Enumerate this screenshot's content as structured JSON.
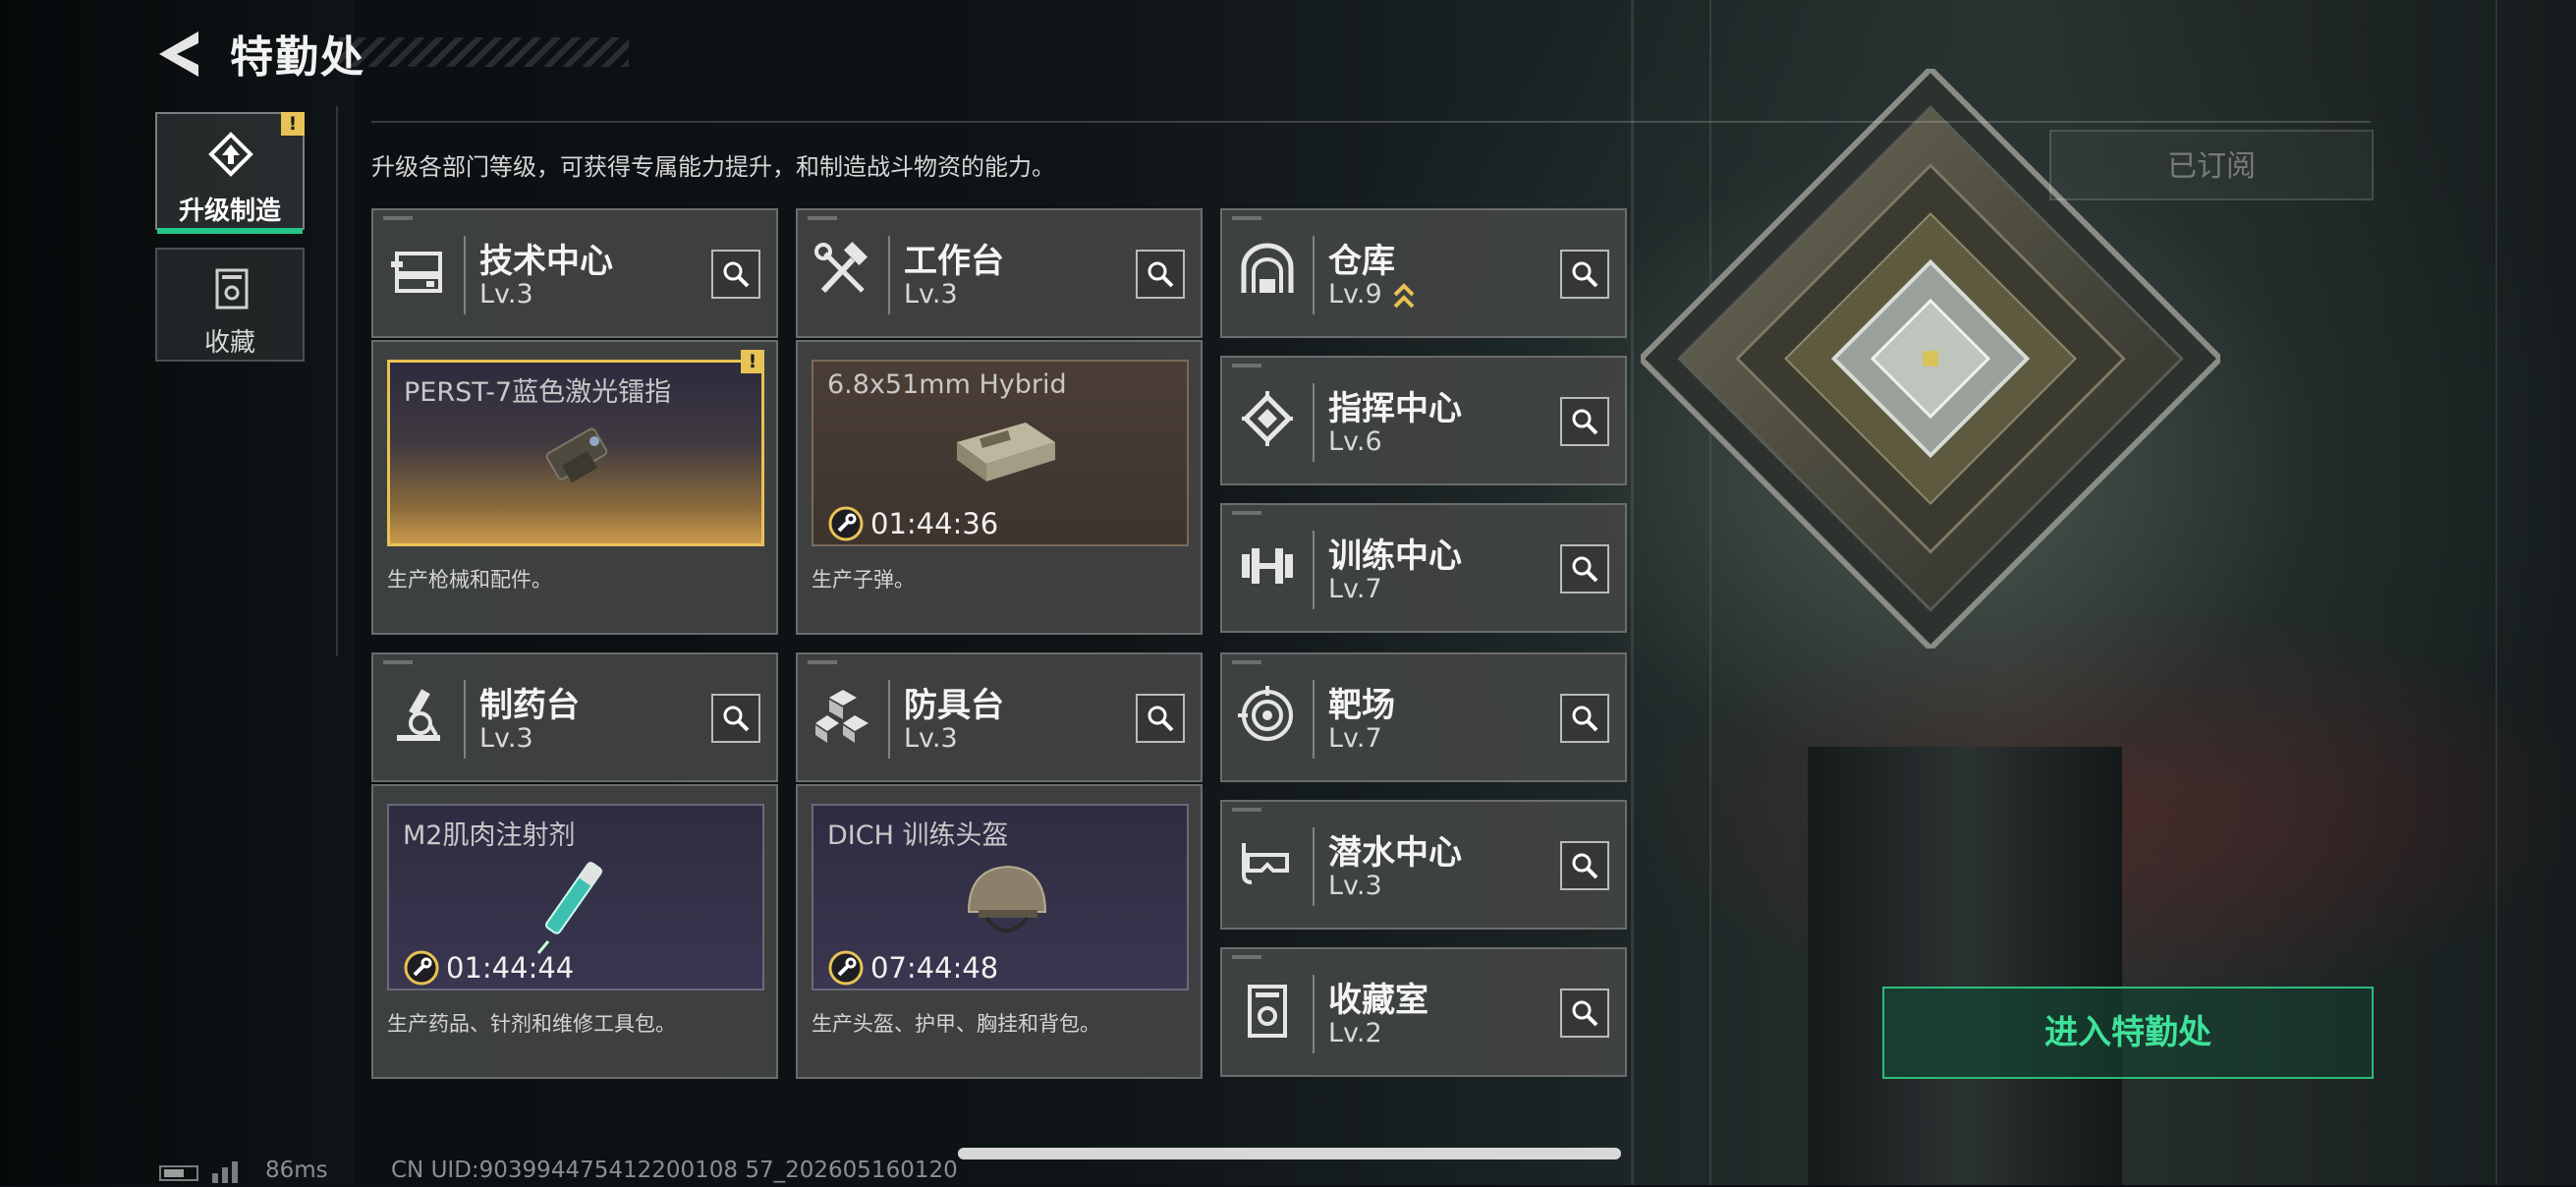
{
  "header": {
    "title": "特勤处"
  },
  "side_tabs": [
    {
      "label": "升级制造",
      "badge": "!"
    },
    {
      "label": "收藏"
    }
  ],
  "description": "升级各部门等级，可获得专属能力提升，和制造战斗物资的能力。",
  "subscribed_label": "已订阅",
  "departments": [
    {
      "name": "技术中心",
      "level": "Lv.3",
      "icon": "tech-center-icon"
    },
    {
      "name": "工作台",
      "level": "Lv.3",
      "icon": "hammer-wrench-icon"
    },
    {
      "name": "仓库",
      "level": "Lv.9",
      "icon": "warehouse-icon",
      "upgrade": true
    },
    {
      "name": "指挥中心",
      "level": "Lv.6",
      "icon": "chip-icon"
    },
    {
      "name": "训练中心",
      "level": "Lv.7",
      "icon": "dumbbell-icon"
    },
    {
      "name": "制药台",
      "level": "Lv.3",
      "icon": "microscope-icon"
    },
    {
      "name": "防具台",
      "level": "Lv.3",
      "icon": "cubes-icon"
    },
    {
      "name": "靶场",
      "level": "Lv.7",
      "icon": "target-icon"
    },
    {
      "name": "潜水中心",
      "level": "Lv.3",
      "icon": "diving-mask-icon"
    },
    {
      "name": "收藏室",
      "level": "Lv.2",
      "icon": "collection-bin-icon"
    }
  ],
  "productions": [
    {
      "item": "PERST-7蓝色激光镭指",
      "desc": "生产枪械和配件。",
      "badge": "!",
      "timer": ""
    },
    {
      "item": "6.8x51mm Hybrid",
      "desc": "生产子弹。",
      "timer": "01:44:36"
    },
    {
      "item": "M2肌肉注射剂",
      "desc": "生产药品、针剂和维修工具包。",
      "timer": "01:44:44"
    },
    {
      "item": "DICH 训练头盔",
      "desc": "生产头盔、护甲、胸挂和背包。",
      "timer": "07:44:48"
    }
  ],
  "enter_button": "进入特勤处",
  "footer": {
    "ping": "86ms",
    "uid": "CN UID:903994475412200108 57_202605160120"
  },
  "colors": {
    "accent": "#2dbb7e",
    "alert": "#e8c255",
    "card": "#424444"
  }
}
